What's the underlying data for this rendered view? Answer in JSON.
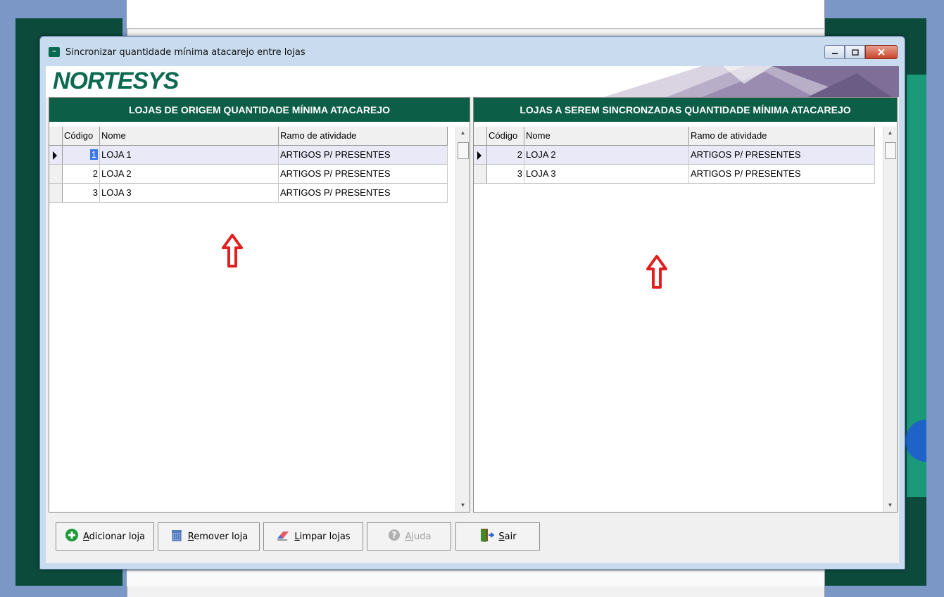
{
  "window": {
    "title": "Sincronizar quantidade mínima atacarejo entre lojas",
    "brand": "NORTESYS"
  },
  "colors": {
    "header_green": "#0d5e47",
    "brand_green": "#0b6a4f",
    "selection_blue": "#3b78e7",
    "arrow_red": "#e11f1f"
  },
  "left_panel": {
    "title": "LOJAS DE ORIGEM QUANTIDADE MÍNIMA ATACAREJO",
    "columns": [
      "Código",
      "Nome",
      "Ramo de atividade"
    ],
    "rows": [
      {
        "codigo": "1",
        "nome": "LOJA 1",
        "ramo": "ARTIGOS P/ PRESENTES"
      },
      {
        "codigo": "2",
        "nome": "LOJA 2",
        "ramo": "ARTIGOS P/ PRESENTES"
      },
      {
        "codigo": "3",
        "nome": "LOJA 3",
        "ramo": "ARTIGOS P/ PRESENTES"
      }
    ]
  },
  "right_panel": {
    "title": "LOJAS A SEREM SINCRONZADAS QUANTIDADE MÍNIMA ATACAREJO",
    "columns": [
      "Código",
      "Nome",
      "Ramo de atividade"
    ],
    "rows": [
      {
        "codigo": "2",
        "nome": "LOJA 2",
        "ramo": "ARTIGOS P/ PRESENTES"
      },
      {
        "codigo": "3",
        "nome": "LOJA 3",
        "ramo": "ARTIGOS P/ PRESENTES"
      }
    ]
  },
  "buttons": {
    "add": {
      "hot": "A",
      "rest": "dicionar loja",
      "icon": "add-icon"
    },
    "remove": {
      "hot": "R",
      "rest": "emover loja",
      "icon": "trash-icon"
    },
    "clear": {
      "hot": "L",
      "rest": "impar lojas",
      "icon": "eraser-icon"
    },
    "help": {
      "hot": "A",
      "rest": "juda",
      "icon": "help-icon"
    },
    "exit": {
      "hot": "S",
      "rest": "air",
      "icon": "exit-door-icon"
    }
  }
}
